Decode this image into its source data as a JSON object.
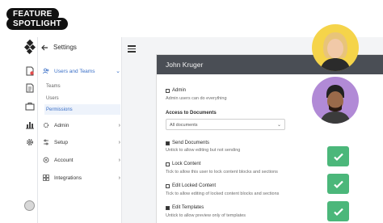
{
  "badge": {
    "line1": "FEATURE",
    "line2": "SPOTLIGHT"
  },
  "nav": {
    "back_title": "Settings",
    "items": [
      {
        "label": "Users and Teams"
      },
      {
        "label": "Admin"
      },
      {
        "label": "Setup"
      },
      {
        "label": "Account"
      },
      {
        "label": "Integrations"
      }
    ],
    "sub_items": [
      {
        "label": "Teams"
      },
      {
        "label": "Users"
      },
      {
        "label": "Permissions"
      }
    ]
  },
  "panel": {
    "user_name": "John Kruger",
    "admin": {
      "label": "Admin",
      "hint": "Admin users can do everything",
      "checked": false
    },
    "access": {
      "label": "Access to Documents",
      "value": "All documents"
    },
    "send": {
      "label": "Send Documents",
      "hint": "Untick to allow editing but not sending",
      "checked": true
    },
    "lock": {
      "label": "Lock Content",
      "hint": "Tick to allow this user to lock content blocks and sections",
      "checked": false
    },
    "edit_locked": {
      "label": "Edit Locked Content",
      "hint": "Tick to allow editing of locked content blocks and sections",
      "checked": false
    },
    "edit_templates": {
      "label": "Edit Templates",
      "hint": "Untick to allow preview only of templates",
      "checked": true
    }
  },
  "colors": {
    "accent": "#3a6fc7",
    "header": "#4a4e55",
    "check_green": "#4bb77a",
    "avatar1_bg": "#f5d44a",
    "avatar2_bg": "#b18ad6"
  }
}
